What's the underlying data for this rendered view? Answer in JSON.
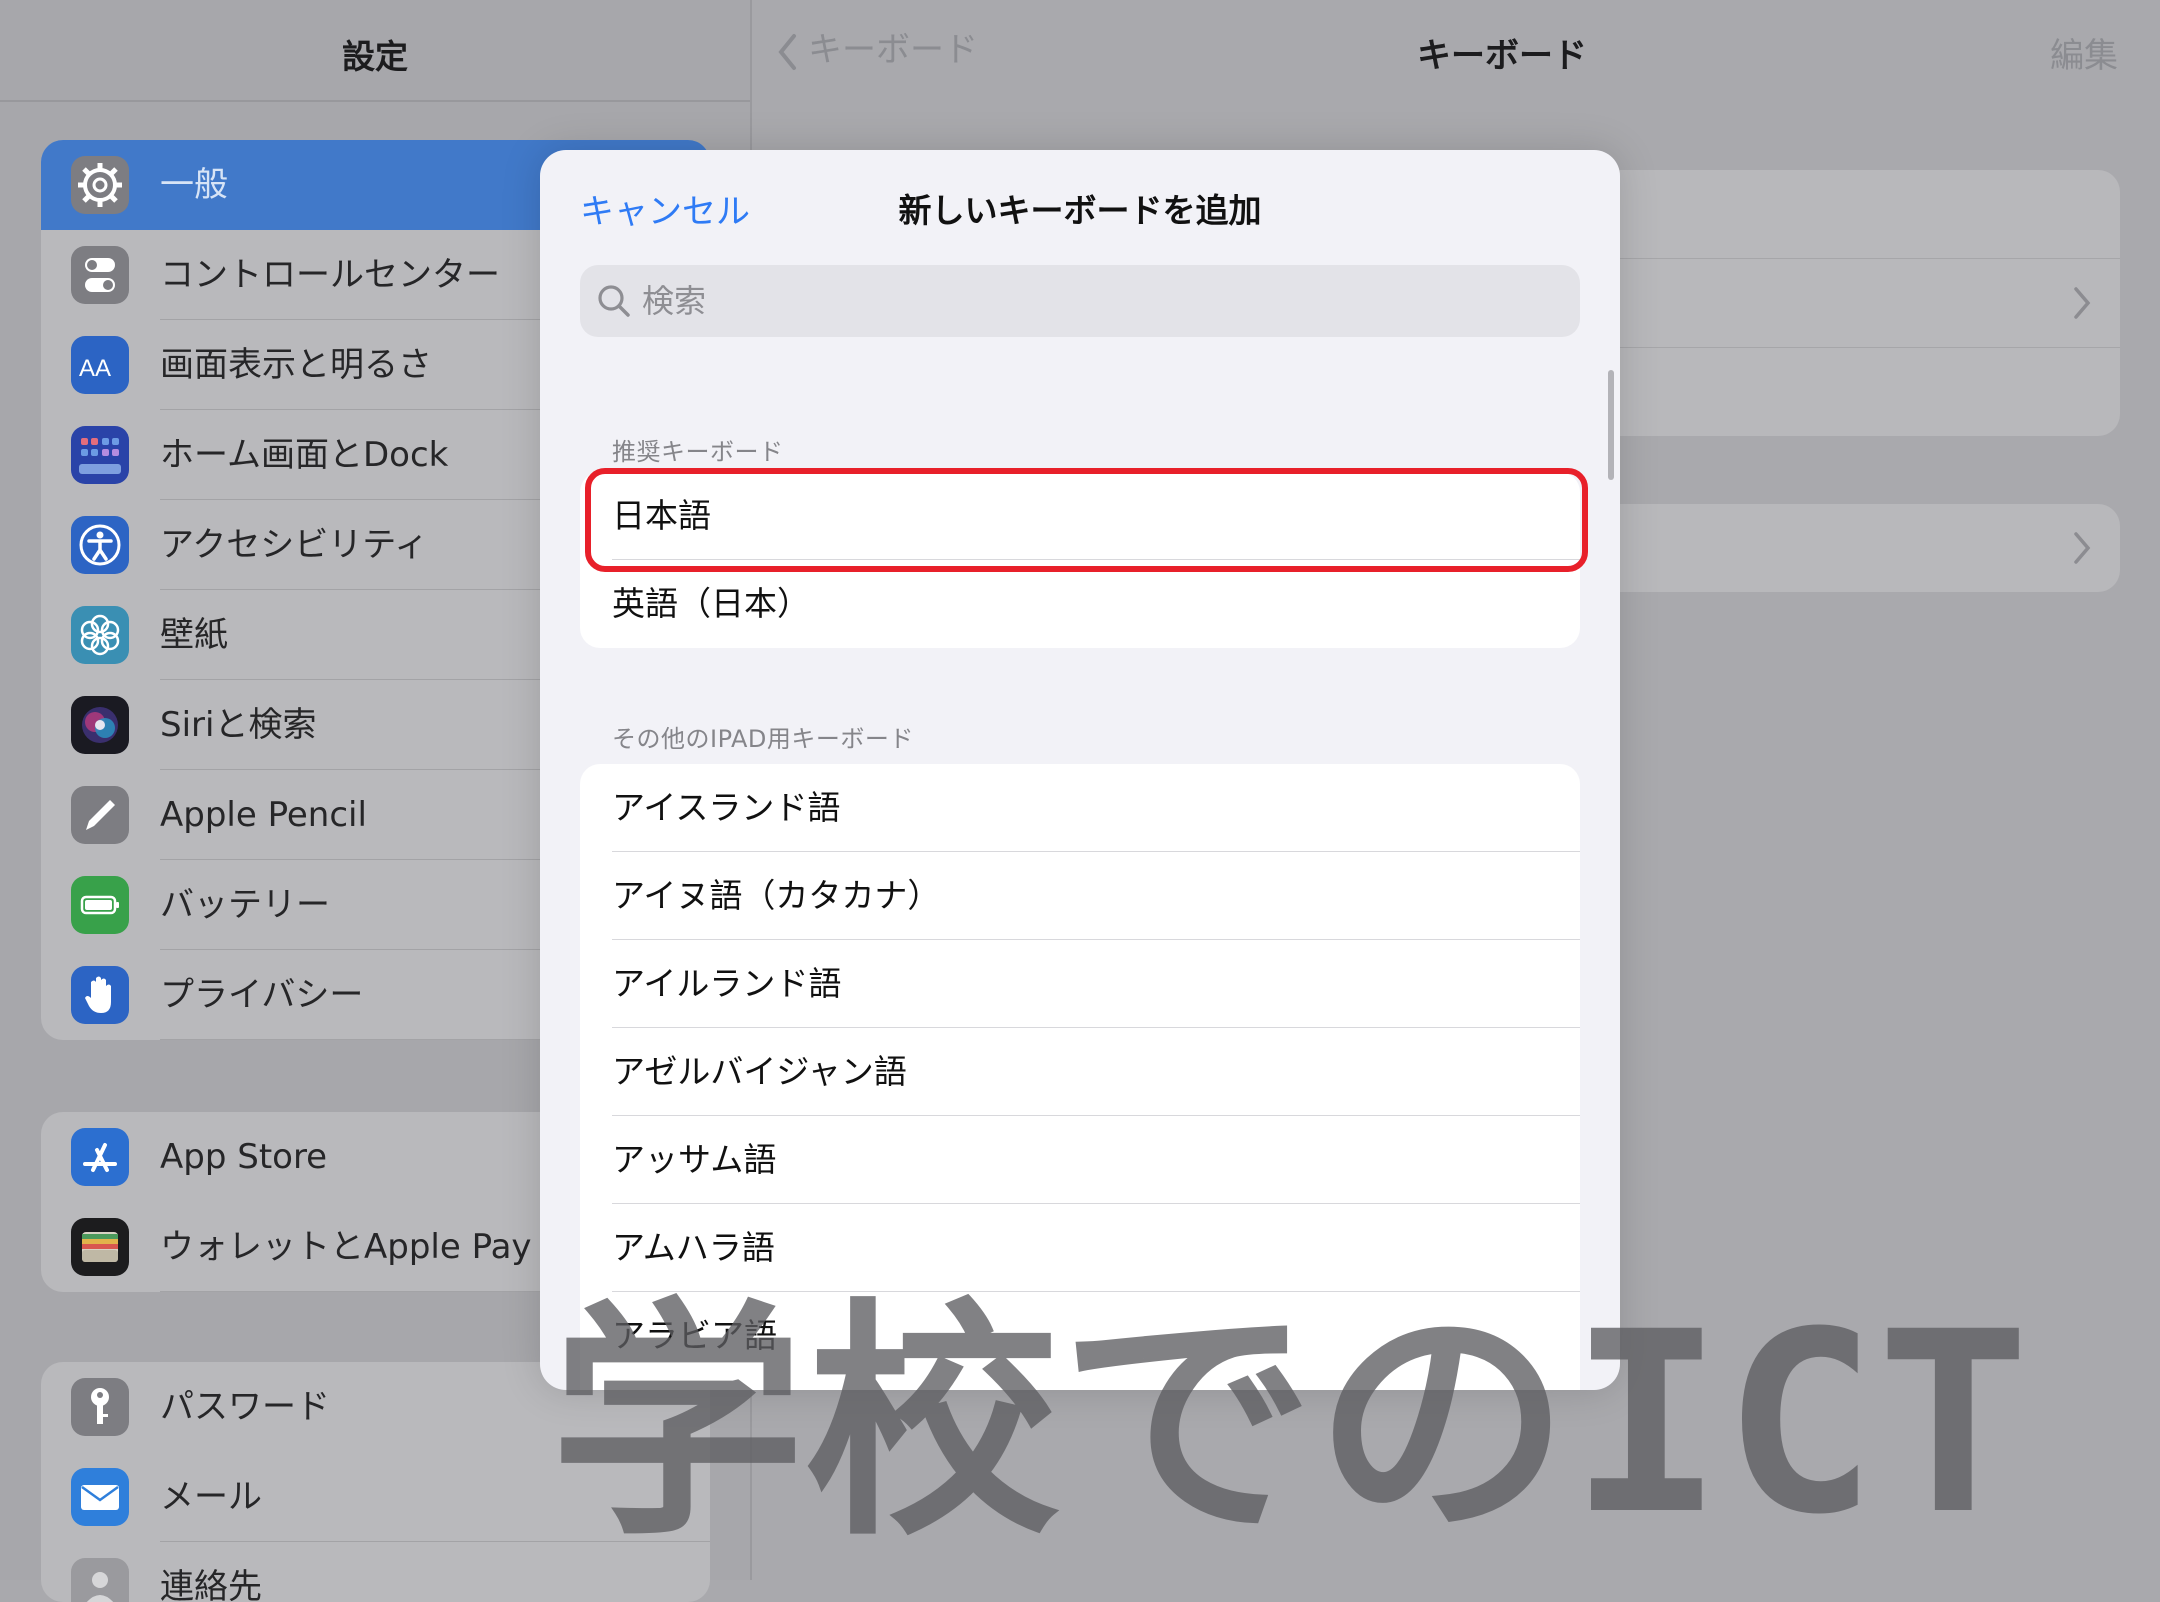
{
  "sidebar": {
    "title": "設定",
    "groups": [
      {
        "items": [
          {
            "label": "一般",
            "icon": "gear-icon",
            "selected": true
          },
          {
            "label": "コントロールセンター",
            "icon": "toggles-icon"
          },
          {
            "label": "画面表示と明るさ",
            "icon": "aa-text-icon"
          },
          {
            "label": "ホーム画面とDock",
            "icon": "home-grid-icon"
          },
          {
            "label": "アクセシビリティ",
            "icon": "accessibility-icon"
          },
          {
            "label": "壁紙",
            "icon": "flower-icon"
          },
          {
            "label": "Siriと検索",
            "icon": "siri-icon"
          },
          {
            "label": "Apple Pencil",
            "icon": "pencil-icon"
          },
          {
            "label": "バッテリー",
            "icon": "battery-icon"
          },
          {
            "label": "プライバシー",
            "icon": "hand-icon"
          }
        ]
      },
      {
        "items": [
          {
            "label": "App Store",
            "icon": "app-store-icon"
          },
          {
            "label": "ウォレットとApple Pay",
            "icon": "wallet-icon"
          }
        ]
      },
      {
        "items": [
          {
            "label": "パスワード",
            "icon": "key-icon"
          },
          {
            "label": "メール",
            "icon": "mail-icon"
          },
          {
            "label": "連絡先",
            "icon": "contacts-icon"
          }
        ]
      }
    ]
  },
  "detail": {
    "back_label": "キーボード",
    "title": "キーボード",
    "edit_label": "編集"
  },
  "modal": {
    "cancel_label": "キャンセル",
    "title": "新しいキーボードを追加",
    "search_placeholder": "検索",
    "suggested_header": "推奨キーボード",
    "suggested": [
      "日本語",
      "英語（日本）"
    ],
    "other_header": "その他のIPAD用キーボード",
    "other": [
      "アイスランド語",
      "アイヌ語（カタカナ）",
      "アイルランド語",
      "アゼルバイジャン語",
      "アッサム語",
      "アムハラ語",
      "アラビア語"
    ]
  },
  "watermark": {
    "text": "学校でのICT"
  },
  "colors": {
    "accent": "#2f7bf5",
    "highlight": "#e8202a",
    "selected_row": "#4179c9"
  }
}
